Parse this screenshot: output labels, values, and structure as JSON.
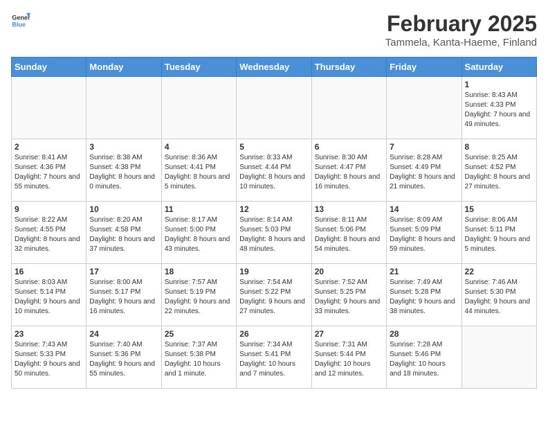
{
  "logo": {
    "general": "General",
    "blue": "Blue"
  },
  "header": {
    "title": "February 2025",
    "subtitle": "Tammela, Kanta-Haeme, Finland"
  },
  "weekdays": [
    "Sunday",
    "Monday",
    "Tuesday",
    "Wednesday",
    "Thursday",
    "Friday",
    "Saturday"
  ],
  "weeks": [
    [
      {
        "day": "",
        "info": ""
      },
      {
        "day": "",
        "info": ""
      },
      {
        "day": "",
        "info": ""
      },
      {
        "day": "",
        "info": ""
      },
      {
        "day": "",
        "info": ""
      },
      {
        "day": "",
        "info": ""
      },
      {
        "day": "1",
        "info": "Sunrise: 8:43 AM\nSunset: 4:33 PM\nDaylight: 7 hours and 49 minutes."
      }
    ],
    [
      {
        "day": "2",
        "info": "Sunrise: 8:41 AM\nSunset: 4:36 PM\nDaylight: 7 hours and 55 minutes."
      },
      {
        "day": "3",
        "info": "Sunrise: 8:38 AM\nSunset: 4:38 PM\nDaylight: 8 hours and 0 minutes."
      },
      {
        "day": "4",
        "info": "Sunrise: 8:36 AM\nSunset: 4:41 PM\nDaylight: 8 hours and 5 minutes."
      },
      {
        "day": "5",
        "info": "Sunrise: 8:33 AM\nSunset: 4:44 PM\nDaylight: 8 hours and 10 minutes."
      },
      {
        "day": "6",
        "info": "Sunrise: 8:30 AM\nSunset: 4:47 PM\nDaylight: 8 hours and 16 minutes."
      },
      {
        "day": "7",
        "info": "Sunrise: 8:28 AM\nSunset: 4:49 PM\nDaylight: 8 hours and 21 minutes."
      },
      {
        "day": "8",
        "info": "Sunrise: 8:25 AM\nSunset: 4:52 PM\nDaylight: 8 hours and 27 minutes."
      }
    ],
    [
      {
        "day": "9",
        "info": "Sunrise: 8:22 AM\nSunset: 4:55 PM\nDaylight: 8 hours and 32 minutes."
      },
      {
        "day": "10",
        "info": "Sunrise: 8:20 AM\nSunset: 4:58 PM\nDaylight: 8 hours and 37 minutes."
      },
      {
        "day": "11",
        "info": "Sunrise: 8:17 AM\nSunset: 5:00 PM\nDaylight: 8 hours and 43 minutes."
      },
      {
        "day": "12",
        "info": "Sunrise: 8:14 AM\nSunset: 5:03 PM\nDaylight: 8 hours and 48 minutes."
      },
      {
        "day": "13",
        "info": "Sunrise: 8:11 AM\nSunset: 5:06 PM\nDaylight: 8 hours and 54 minutes."
      },
      {
        "day": "14",
        "info": "Sunrise: 8:09 AM\nSunset: 5:09 PM\nDaylight: 8 hours and 59 minutes."
      },
      {
        "day": "15",
        "info": "Sunrise: 8:06 AM\nSunset: 5:11 PM\nDaylight: 9 hours and 5 minutes."
      }
    ],
    [
      {
        "day": "16",
        "info": "Sunrise: 8:03 AM\nSunset: 5:14 PM\nDaylight: 9 hours and 10 minutes."
      },
      {
        "day": "17",
        "info": "Sunrise: 8:00 AM\nSunset: 5:17 PM\nDaylight: 9 hours and 16 minutes."
      },
      {
        "day": "18",
        "info": "Sunrise: 7:57 AM\nSunset: 5:19 PM\nDaylight: 9 hours and 22 minutes."
      },
      {
        "day": "19",
        "info": "Sunrise: 7:54 AM\nSunset: 5:22 PM\nDaylight: 9 hours and 27 minutes."
      },
      {
        "day": "20",
        "info": "Sunrise: 7:52 AM\nSunset: 5:25 PM\nDaylight: 9 hours and 33 minutes."
      },
      {
        "day": "21",
        "info": "Sunrise: 7:49 AM\nSunset: 5:28 PM\nDaylight: 9 hours and 38 minutes."
      },
      {
        "day": "22",
        "info": "Sunrise: 7:46 AM\nSunset: 5:30 PM\nDaylight: 9 hours and 44 minutes."
      }
    ],
    [
      {
        "day": "23",
        "info": "Sunrise: 7:43 AM\nSunset: 5:33 PM\nDaylight: 9 hours and 50 minutes."
      },
      {
        "day": "24",
        "info": "Sunrise: 7:40 AM\nSunset: 5:36 PM\nDaylight: 9 hours and 55 minutes."
      },
      {
        "day": "25",
        "info": "Sunrise: 7:37 AM\nSunset: 5:38 PM\nDaylight: 10 hours and 1 minute."
      },
      {
        "day": "26",
        "info": "Sunrise: 7:34 AM\nSunset: 5:41 PM\nDaylight: 10 hours and 7 minutes."
      },
      {
        "day": "27",
        "info": "Sunrise: 7:31 AM\nSunset: 5:44 PM\nDaylight: 10 hours and 12 minutes."
      },
      {
        "day": "28",
        "info": "Sunrise: 7:28 AM\nSunset: 5:46 PM\nDaylight: 10 hours and 18 minutes."
      },
      {
        "day": "",
        "info": ""
      }
    ]
  ]
}
